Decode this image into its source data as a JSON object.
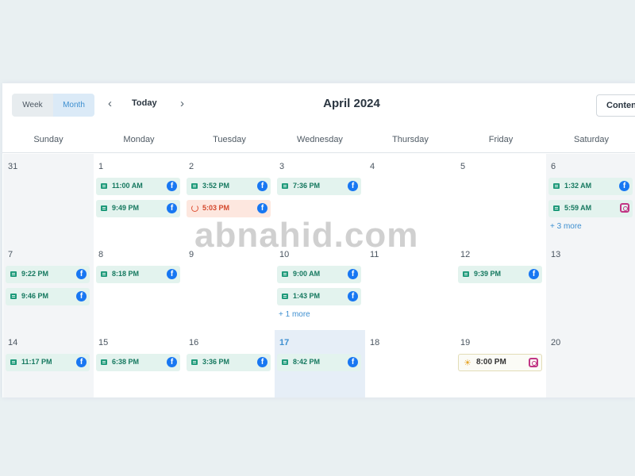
{
  "toolbar": {
    "week_label": "Week",
    "month_label": "Month",
    "today_label": "Today",
    "prev_icon": "chevron-left-icon",
    "next_icon": "chevron-right-icon",
    "month_title": "April 2024",
    "content_label": "Conten"
  },
  "weekdays": [
    "Sunday",
    "Monday",
    "Tuesday",
    "Wednesday",
    "Thursday",
    "Friday",
    "Saturday"
  ],
  "weeks": [
    {
      "days": [
        {
          "num": "31",
          "events": [],
          "more": ""
        },
        {
          "num": "1",
          "events": [
            {
              "time": "11:00 AM"
            },
            {
              "time": "9:49 PM"
            }
          ],
          "more": ""
        },
        {
          "num": "2",
          "events": [
            {
              "time": "3:52 PM"
            },
            {
              "time": "5:03 PM"
            }
          ],
          "more": ""
        },
        {
          "num": "3",
          "events": [
            {
              "time": "7:36 PM"
            }
          ],
          "more": ""
        },
        {
          "num": "4",
          "events": [],
          "more": ""
        },
        {
          "num": "5",
          "events": [],
          "more": ""
        },
        {
          "num": "6",
          "events": [
            {
              "time": "1:32 AM"
            },
            {
              "time": "5:59 AM"
            }
          ],
          "more": "+ 3 more"
        }
      ]
    },
    {
      "days": [
        {
          "num": "7",
          "events": [
            {
              "time": "9:22 PM"
            },
            {
              "time": "9:46 PM"
            }
          ],
          "more": ""
        },
        {
          "num": "8",
          "events": [
            {
              "time": "8:18 PM"
            }
          ],
          "more": ""
        },
        {
          "num": "9",
          "events": [],
          "more": ""
        },
        {
          "num": "10",
          "events": [
            {
              "time": "9:00 AM"
            },
            {
              "time": "1:43 PM"
            }
          ],
          "more": "+ 1 more"
        },
        {
          "num": "11",
          "events": [],
          "more": ""
        },
        {
          "num": "12",
          "events": [
            {
              "time": "9:39 PM"
            }
          ],
          "more": ""
        },
        {
          "num": "13",
          "events": [],
          "more": ""
        }
      ]
    },
    {
      "days": [
        {
          "num": "14",
          "events": [
            {
              "time": "11:17 PM"
            }
          ],
          "more": ""
        },
        {
          "num": "15",
          "events": [
            {
              "time": "6:38 PM"
            }
          ],
          "more": ""
        },
        {
          "num": "16",
          "events": [
            {
              "time": "3:36 PM"
            }
          ],
          "more": ""
        },
        {
          "num": "17",
          "events": [
            {
              "time": "8:42 PM"
            }
          ],
          "more": ""
        },
        {
          "num": "18",
          "events": [],
          "more": ""
        },
        {
          "num": "19",
          "events": [
            {
              "time": "8:00 PM"
            }
          ],
          "more": ""
        },
        {
          "num": "20",
          "events": [],
          "more": ""
        }
      ]
    }
  ],
  "watermark": "abnahid.com",
  "colors": {
    "accent": "#3e8fd0",
    "event_bg": "#e3f3ee",
    "event_text": "#15785f",
    "error_bg": "#fde7df",
    "error_text": "#d4482c",
    "facebook": "#1877f2",
    "instagram": "#c13584"
  }
}
